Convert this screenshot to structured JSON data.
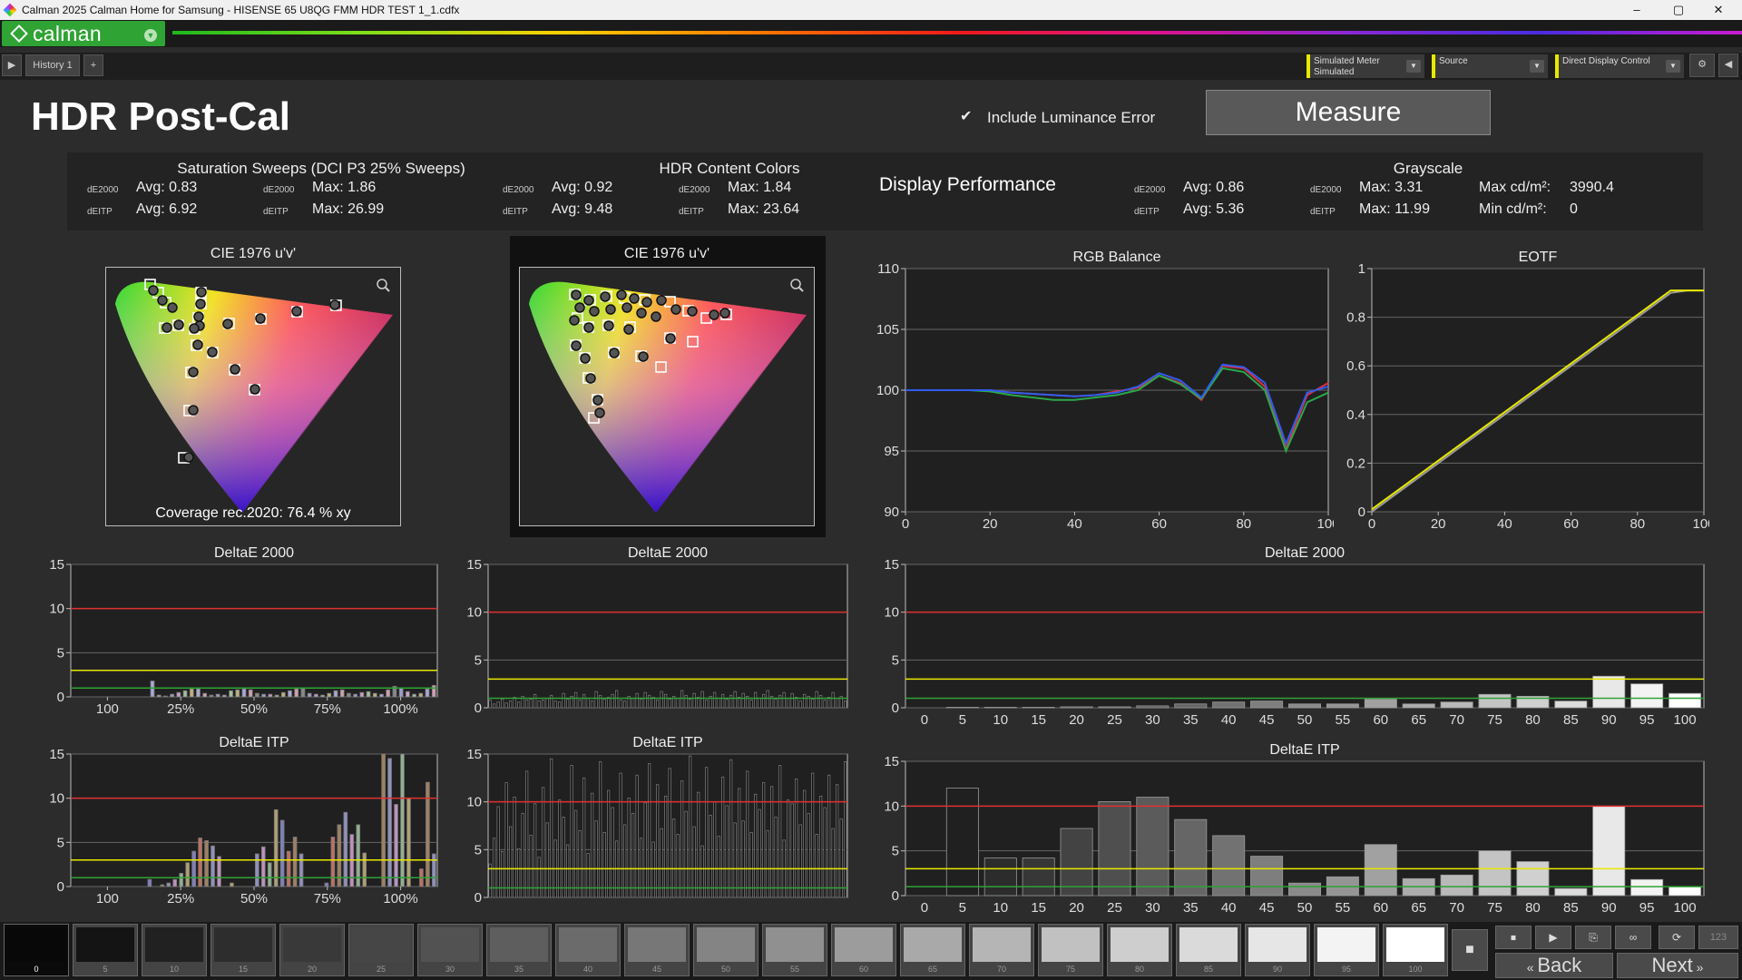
{
  "window": {
    "title": "Calman 2025 Calman Home for Samsung  - HISENSE 65 U8QG FMM HDR TEST 1_1.cdfx",
    "minimize": "–",
    "maximize": "▢",
    "close": "✕"
  },
  "app": {
    "logo": "calman"
  },
  "tabs": [
    {
      "label": "History 1"
    },
    {
      "label": "+"
    }
  ],
  "toolbar": {
    "meter": {
      "line1": "Simulated Meter",
      "line2": "Simulated"
    },
    "source": {
      "line1": "Source",
      "line2": ""
    },
    "display": {
      "line1": "Direct Display Control",
      "line2": ""
    }
  },
  "page": {
    "title": "HDR Post-Cal",
    "include_luminance_label": "Include Luminance Error",
    "include_luminance_checked": true,
    "measure_button": "Measure"
  },
  "stats": {
    "saturation": {
      "title": "Saturation Sweeps (DCI P3 25% Sweeps)",
      "de2000_label": "dE2000",
      "ditp_label": "dEITP",
      "de2000_avg": "Avg: 0.83",
      "de2000_max": "Max: 1.86",
      "ditp_avg": "Avg: 6.92",
      "ditp_max": "Max: 26.99"
    },
    "content": {
      "title": "HDR Content Colors",
      "de2000_label": "dE2000",
      "ditp_label": "dEITP",
      "de2000_avg": "Avg: 0.92",
      "de2000_max": "Max: 1.84",
      "ditp_avg": "Avg: 9.48",
      "ditp_max": "Max: 23.64"
    },
    "performance": {
      "title": "Display Performance"
    },
    "grayscale": {
      "title": "Grayscale",
      "de2000_label": "dE2000",
      "ditp_label": "dEITP",
      "de2000_avg": "Avg: 0.86",
      "de2000_max": "Max: 3.31",
      "ditp_avg": "Avg: 5.36",
      "ditp_max": "Max: 11.99",
      "max_lum_label": "Max cd/m²:",
      "max_lum": "3990.4",
      "min_lum_label": "Min cd/m²:",
      "min_lum": "0"
    }
  },
  "cie": {
    "left_title": "CIE 1976 u'v'",
    "right_title": "CIE 1976 u'v'",
    "coverage": "Coverage rec.2020:  76.4 % xy"
  },
  "chart_data": [
    {
      "id": "rgb",
      "type": "line",
      "title": "RGB Balance",
      "x": [
        0,
        5,
        10,
        15,
        20,
        25,
        30,
        35,
        40,
        45,
        50,
        55,
        60,
        65,
        70,
        75,
        80,
        85,
        90,
        95,
        100
      ],
      "xlim": [
        0,
        100
      ],
      "ylim": [
        90,
        110
      ],
      "xticks": [
        0,
        20,
        40,
        60,
        80,
        100
      ],
      "yticks": [
        90,
        95,
        100,
        105,
        110
      ],
      "series": [
        {
          "color": "#e0303a",
          "values": [
            100,
            100,
            100,
            100,
            100,
            99.8,
            99.7,
            99.6,
            99.5,
            99.6,
            99.9,
            100.2,
            101.2,
            100.6,
            99.2,
            102,
            101.8,
            100.3,
            95.2,
            99.6,
            100.6
          ]
        },
        {
          "color": "#2aa84a",
          "values": [
            100,
            100,
            100,
            100,
            99.9,
            99.6,
            99.4,
            99.2,
            99.2,
            99.4,
            99.6,
            100,
            101.2,
            100.5,
            99.3,
            101.8,
            101.5,
            100,
            95,
            99,
            99.8
          ]
        },
        {
          "color": "#2f5cf0",
          "values": [
            100,
            100,
            100,
            100,
            100,
            99.8,
            99.7,
            99.6,
            99.5,
            99.6,
            99.8,
            100.3,
            101.4,
            100.8,
            99.4,
            102.1,
            101.9,
            100.6,
            95.6,
            99.8,
            100.3
          ]
        }
      ]
    },
    {
      "id": "eotf",
      "type": "line",
      "title": "EOTF",
      "x": [
        0,
        5,
        10,
        15,
        20,
        25,
        30,
        35,
        40,
        45,
        50,
        55,
        60,
        65,
        70,
        75,
        80,
        85,
        90,
        95,
        100
      ],
      "xlim": [
        0,
        100
      ],
      "ylim": [
        0,
        1
      ],
      "xticks": [
        0,
        20,
        40,
        60,
        80,
        100
      ],
      "yticks": [
        0,
        0.2,
        0.4,
        0.6,
        0.8,
        1
      ],
      "series": [
        {
          "color": "#9a9a9a",
          "values": [
            0,
            0.05,
            0.1,
            0.15,
            0.2,
            0.25,
            0.3,
            0.35,
            0.4,
            0.45,
            0.5,
            0.55,
            0.6,
            0.65,
            0.7,
            0.75,
            0.8,
            0.85,
            0.9,
            0.91,
            0.91
          ]
        },
        {
          "color": "#e8e800",
          "values": [
            0.01,
            0.06,
            0.11,
            0.16,
            0.21,
            0.26,
            0.31,
            0.36,
            0.41,
            0.46,
            0.51,
            0.56,
            0.61,
            0.66,
            0.71,
            0.76,
            0.81,
            0.86,
            0.91,
            0.91,
            0.91
          ]
        }
      ]
    },
    {
      "id": "sat_de",
      "type": "bar",
      "title": "DeltaE 2000",
      "xticks": [
        "100",
        "25%",
        "50%",
        "75%",
        "100%"
      ],
      "ylim": [
        0,
        15
      ],
      "yticks": [
        0,
        5,
        10,
        15
      ],
      "redline": 10,
      "yellowline": 3,
      "greenline": 1,
      "values": [
        0,
        0,
        0,
        0,
        0,
        0,
        0,
        0,
        0,
        0,
        0,
        0,
        1.8,
        0.2,
        0.1,
        0.3,
        0.5,
        0.7,
        0.9,
        0.9,
        0.4,
        0.2,
        0.3,
        0.2,
        0.7,
        0.8,
        0.9,
        0.8,
        0.4,
        0.3,
        0.3,
        0.2,
        0.5,
        0.7,
        0.9,
        1.0,
        0.4,
        0.3,
        0.2,
        0.4,
        0.7,
        0.8,
        0.4,
        0.3,
        0.5,
        0.6,
        0.4,
        0.3,
        0.8,
        1.2,
        1.0,
        0.6,
        0.3,
        0.4,
        0.9,
        1.3
      ],
      "colors": [
        "#888",
        "#9d9dd0",
        "#c7a0c7",
        "#a0c0a0",
        "#c0b080",
        "#a8a8d8",
        "#d0a0b0"
      ]
    },
    {
      "id": "sat_itp",
      "type": "bar",
      "title": "DeltaE ITP",
      "xticks": [
        "100",
        "25%",
        "50%",
        "75%",
        "100%"
      ],
      "ylim": [
        0,
        15
      ],
      "yticks": [
        0,
        5,
        10,
        15
      ],
      "redline": 10,
      "yellowline": 3,
      "greenline": 1,
      "values": [
        0,
        0,
        0,
        0,
        0,
        0,
        0,
        0,
        0,
        0,
        0,
        0,
        0.8,
        0,
        0.2,
        0.4,
        0.8,
        1.5,
        2.7,
        4.0,
        5.5,
        5.2,
        4.6,
        3.4,
        0,
        0.4,
        0,
        0,
        0,
        3.7,
        4.5,
        2.7,
        8.7,
        7.5,
        4.0,
        5.6,
        3.7,
        0,
        0,
        0,
        0.4,
        5.6,
        7.0,
        8.4,
        5.9,
        7.0,
        3.8,
        0,
        0,
        15,
        14.5,
        9.3,
        15,
        10,
        0,
        2,
        11.8,
        3.7
      ],
      "colors": [
        "#a08060",
        "#9090c0",
        "#c090c0",
        "#90b090",
        "#b0a070",
        "#8080c0",
        "#c07060"
      ]
    },
    {
      "id": "hdr_de",
      "type": "bar",
      "title": "DeltaE 2000",
      "ylim": [
        0,
        15
      ],
      "yticks": [
        0,
        5,
        10,
        15
      ],
      "redline": 10,
      "yellowline": 3,
      "greenline": 1,
      "values": [
        0.8,
        0.4,
        0.6,
        0.9,
        0.5,
        0.7,
        1.1,
        0.6,
        1.2,
        0.8,
        0.9,
        1.4,
        0.7,
        0.8,
        1.0,
        1.3,
        0.7,
        0.6,
        1.5,
        0.9,
        1.2,
        1.6,
        0.8,
        1.4,
        1.0,
        0.7,
        1.7,
        1.3,
        0.9,
        1.1,
        1.4,
        1.8,
        0.8,
        0.7,
        1.2,
        1.0,
        1.5,
        0.9,
        1.6,
        1.3,
        1.1,
        0.8,
        1.7,
        1.4,
        0.9,
        1.2,
        1.0,
        1.8,
        1.3,
        0.9,
        1.5,
        1.1,
        1.7,
        0.8,
        1.2,
        1.6,
        1.0,
        1.4,
        0.9,
        1.3,
        1.7,
        1.1,
        1.5,
        1.2,
        0.8,
        1.6,
        1.0,
        1.4,
        1.8,
        1.2,
        0.9,
        1.3,
        1.6,
        1.0,
        1.5,
        1.1,
        0.7,
        1.4,
        1.2,
        0.9,
        1.7,
        1.3,
        0.8,
        1.1,
        1.6,
        1.0,
        1.2,
        0.7
      ]
    },
    {
      "id": "hdr_itp",
      "type": "bar",
      "title": "DeltaE ITP",
      "ylim": [
        0,
        15
      ],
      "yticks": [
        0,
        5,
        10,
        15
      ],
      "redline": 10,
      "yellowline": 3,
      "greenline": 1,
      "values": [
        3.5,
        6.2,
        9.5,
        4.8,
        12.0,
        7.4,
        10.5,
        5.1,
        8.8,
        13.2,
        6.5,
        9.8,
        4.2,
        11.5,
        7.8,
        14.5,
        6.0,
        10.2,
        8.4,
        5.5,
        13.8,
        9.1,
        7.0,
        12.5,
        4.6,
        10.9,
        8.0,
        14.2,
        6.8,
        11.2,
        9.4,
        5.9,
        13.0,
        7.6,
        10.4,
        8.8,
        12.8,
        6.2,
        9.9,
        14.0,
        5.8,
        11.8,
        7.2,
        10.6,
        13.5,
        8.2,
        6.6,
        12.2,
        9.0,
        14.8,
        7.4,
        11.0,
        5.4,
        13.6,
        8.6,
        10.0,
        6.4,
        12.6,
        9.6,
        14.4,
        7.8,
        11.4,
        8.0,
        13.2,
        6.8,
        10.8,
        9.2,
        12.0,
        7.0,
        11.6,
        8.4,
        13.8,
        6.0,
        10.2,
        9.8,
        12.4,
        7.6,
        11.2,
        8.8,
        13.0,
        6.6,
        10.6,
        9.4,
        12.8,
        7.2,
        11.8,
        8.2,
        14.2
      ]
    },
    {
      "id": "gs_de",
      "type": "bar",
      "title": "DeltaE 2000",
      "categories": [
        "0",
        "5",
        "10",
        "15",
        "20",
        "25",
        "30",
        "35",
        "40",
        "45",
        "50",
        "55",
        "60",
        "65",
        "70",
        "75",
        "80",
        "85",
        "90",
        "95",
        "100"
      ],
      "ylim": [
        0,
        15
      ],
      "yticks": [
        0,
        5,
        10,
        15
      ],
      "redline": 10,
      "yellowline": 3,
      "greenline": 1,
      "values": [
        0,
        0.05,
        0.05,
        0.05,
        0.1,
        0.1,
        0.2,
        0.4,
        0.6,
        0.7,
        0.4,
        0.4,
        0.9,
        0.4,
        0.6,
        1.4,
        1.2,
        0.7,
        3.3,
        2.5,
        1.5
      ]
    },
    {
      "id": "gs_itp",
      "type": "bar",
      "title": "DeltaE ITP",
      "categories": [
        "0",
        "5",
        "10",
        "15",
        "20",
        "25",
        "30",
        "35",
        "40",
        "45",
        "50",
        "55",
        "60",
        "65",
        "70",
        "75",
        "80",
        "85",
        "90",
        "95",
        "100"
      ],
      "ylim": [
        0,
        15
      ],
      "yticks": [
        0,
        5,
        10,
        15
      ],
      "redline": 10,
      "yellowline": 3,
      "greenline": 1,
      "values": [
        0,
        12,
        4.2,
        4.2,
        7.5,
        10.5,
        11,
        8.5,
        6.7,
        4.4,
        1.4,
        2.1,
        5.7,
        1.9,
        2.3,
        5.0,
        3.8,
        0.8,
        10,
        1.8,
        1.0
      ]
    }
  ],
  "swatches": [
    "0",
    "5",
    "10",
    "15",
    "20",
    "25",
    "30",
    "35",
    "40",
    "45",
    "50",
    "55",
    "60",
    "65",
    "70",
    "75",
    "80",
    "85",
    "90",
    "95",
    "100"
  ],
  "bottom_nav": {
    "back": "Back",
    "next": "Next",
    "counter": "123"
  }
}
